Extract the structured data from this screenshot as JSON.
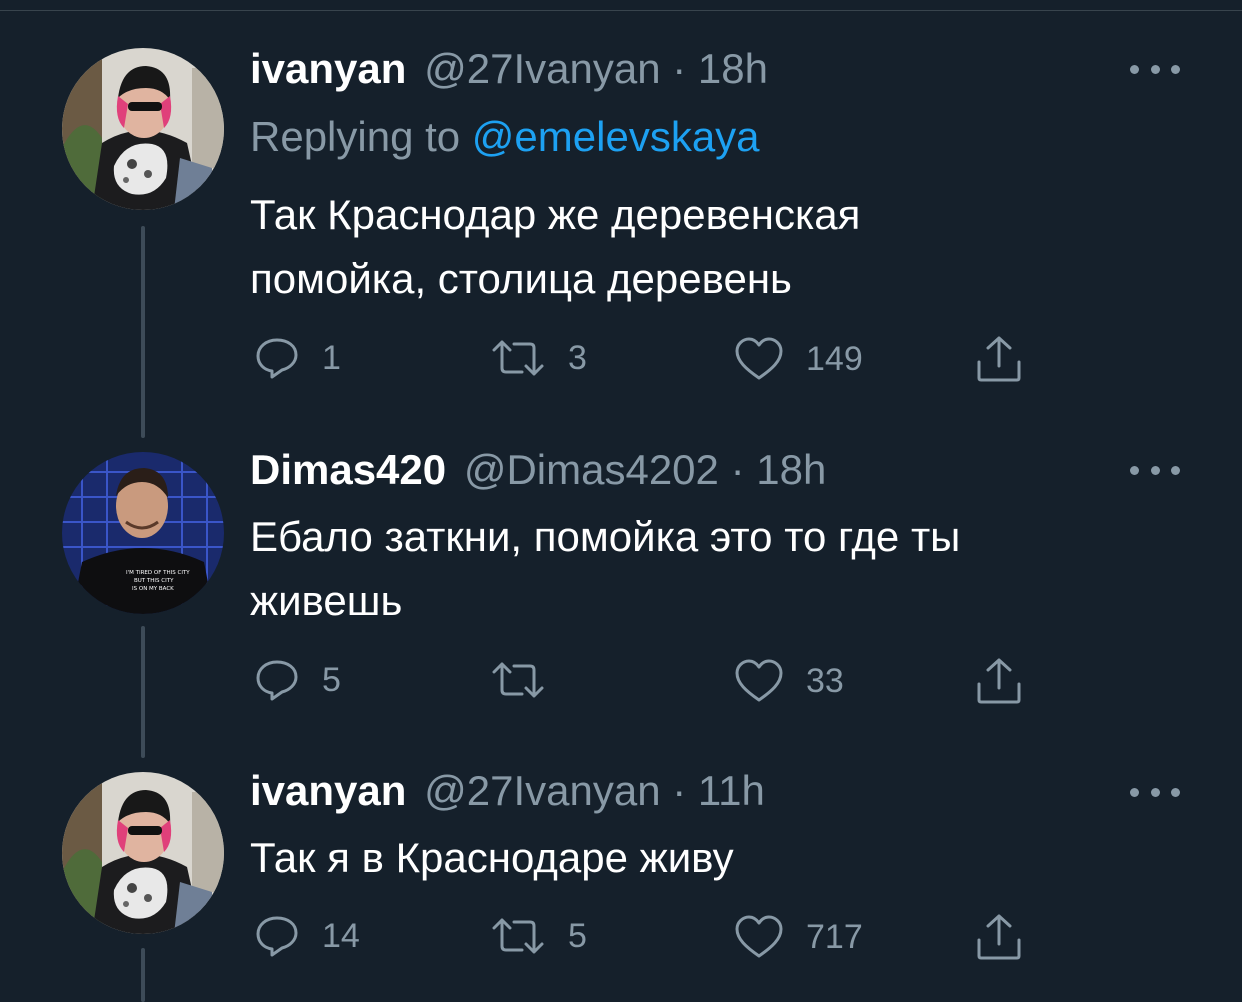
{
  "tweets": [
    {
      "display_name": "ivanyan",
      "handle": "@27Ivanyan",
      "separator": "·",
      "time": "18h",
      "replying_label": "Replying to",
      "replying_to": "@emelevskaya",
      "text": "Так Краснодар же деревенская\nпомойка, столица деревень",
      "replies": "1",
      "retweets": "3",
      "likes": "149"
    },
    {
      "display_name": "Dimas420",
      "handle": "@Dimas4202",
      "separator": "·",
      "time": "18h",
      "text": "Ебало заткни, помойка это то где ты\nживешь",
      "replies": "5",
      "retweets": "",
      "likes": "33"
    },
    {
      "display_name": "ivanyan",
      "handle": "@27Ivanyan",
      "separator": "·",
      "time": "11h",
      "text": "Так я в Краснодаре живу",
      "replies": "14",
      "retweets": "5",
      "likes": "717"
    }
  ],
  "avatar_shirt_text": "I'M TIRED OF THIS CITY BUT THIS CITY IS ON MY BACK",
  "icons": {
    "reply": "reply-icon",
    "retweet": "retweet-icon",
    "like": "heart-icon",
    "share": "share-icon",
    "more": "more-dots-icon"
  },
  "colors": {
    "background": "#15202b",
    "primary_text": "#ffffff",
    "secondary_text": "#8899a6",
    "mention": "#1da1f2",
    "thread_line": "#3d4b58"
  }
}
